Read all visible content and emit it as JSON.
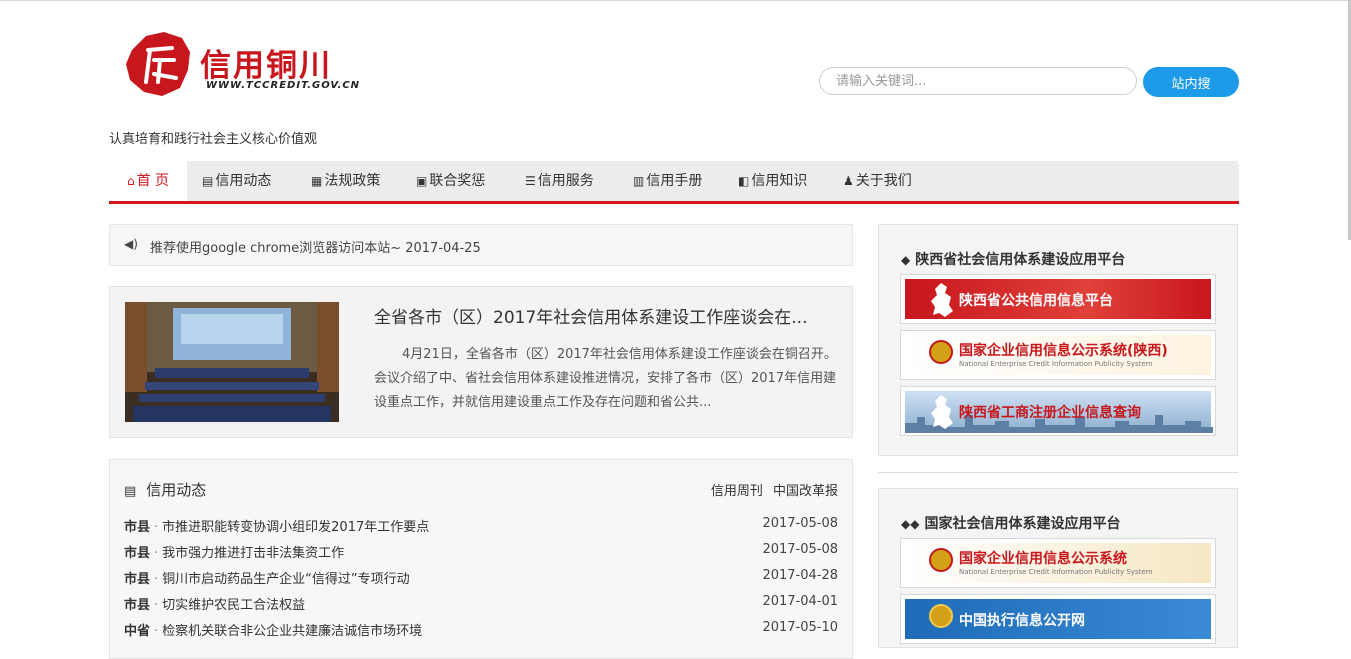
{
  "header": {
    "logo_title": "信用铜川",
    "logo_url": "WWW.TCCREDIT.GOV.CN",
    "slogan": "认真培育和践行社会主义核心价值观"
  },
  "search": {
    "placeholder": "请输入关键词...",
    "value": "",
    "button_label": "站内搜"
  },
  "nav": {
    "items": [
      {
        "label": "首 页",
        "icon": "home-icon"
      },
      {
        "label": "信用动态",
        "icon": "newspaper-icon"
      },
      {
        "label": "法规政策",
        "icon": "document-icon"
      },
      {
        "label": "联合奖惩",
        "icon": "book-icon"
      },
      {
        "label": "信用服务",
        "icon": "list-icon"
      },
      {
        "label": "信用手册",
        "icon": "manual-icon"
      },
      {
        "label": "信用知识",
        "icon": "share-icon"
      },
      {
        "label": "关于我们",
        "icon": "user-plus-icon"
      }
    ]
  },
  "notice": {
    "text": "推荐使用google chrome浏览器访问本站~ 2017-04-25"
  },
  "feature": {
    "title": "全省各市（区）2017年社会信用体系建设工作座谈会在...",
    "description": "4月21日，全省各市（区）2017年社会信用体系建设工作座谈会在铜召开。会议介绍了中、省社会信用体系建设推进情况，安排了各市（区）2017年信用建设重点工作，并就信用建设重点工作及存在问题和省公共..."
  },
  "news": {
    "heading": "信用动态",
    "links": [
      "信用周刊",
      "中国改革报"
    ],
    "rows": [
      {
        "category": "市县",
        "title": "市推进职能转变协调小组印发2017年工作要点",
        "date": "2017-05-08"
      },
      {
        "category": "市县",
        "title": "我市强力推进打击非法集资工作",
        "date": "2017-05-08"
      },
      {
        "category": "市县",
        "title": "铜川市启动药品生产企业“信得过”专项行动",
        "date": "2017-04-28"
      },
      {
        "category": "市县",
        "title": "切实维护农民工合法权益",
        "date": "2017-04-01"
      },
      {
        "category": "中省",
        "title": "检察机关联合非公企业共建廉洁诚信市场环境",
        "date": "2017-05-10"
      }
    ]
  },
  "sidebar": {
    "panel1_title": "陕西省社会信用体系建设应用平台",
    "panel2_title": "国家社会信用体系建设应用平台",
    "banners1": [
      {
        "label": "陕西省公共信用信息平台",
        "sub": ""
      },
      {
        "label": "国家企业信用信息公示系统(陕西)",
        "sub": "National Enterprise Credit Information Publicity System"
      },
      {
        "label": "陕西省工商注册企业信息查询",
        "sub": ""
      }
    ],
    "banners2": [
      {
        "label": "国家企业信用信息公示系统",
        "sub": "National Enterprise Credit Information Publicity System"
      },
      {
        "label": "中国执行信息公开网",
        "sub": ""
      }
    ]
  },
  "colors": {
    "brand_red": "#d7151c",
    "search_blue": "#1e9be8"
  }
}
